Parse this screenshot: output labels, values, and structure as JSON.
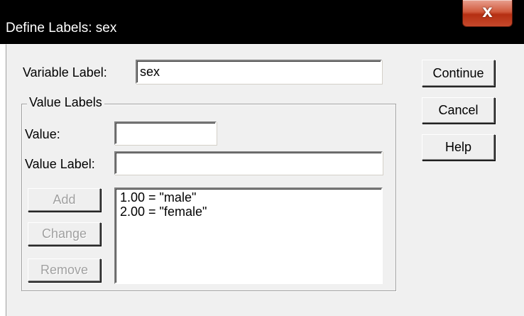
{
  "window": {
    "title": "Define Labels: sex",
    "close_glyph": "X"
  },
  "variable_label": {
    "label": "Variable Label:",
    "value": "sex"
  },
  "value_labels": {
    "group_title": "Value Labels",
    "value_label": "Value:",
    "value_value": "",
    "value_label_label": "Value Label:",
    "value_label_value": "",
    "add_label": "Add",
    "change_label": "Change",
    "remove_label": "Remove",
    "list": [
      "1.00 = \"male\"",
      "2.00 = \"female\""
    ]
  },
  "buttons": {
    "continue_label": "Continue",
    "cancel_label": "Cancel",
    "help_label": "Help"
  }
}
